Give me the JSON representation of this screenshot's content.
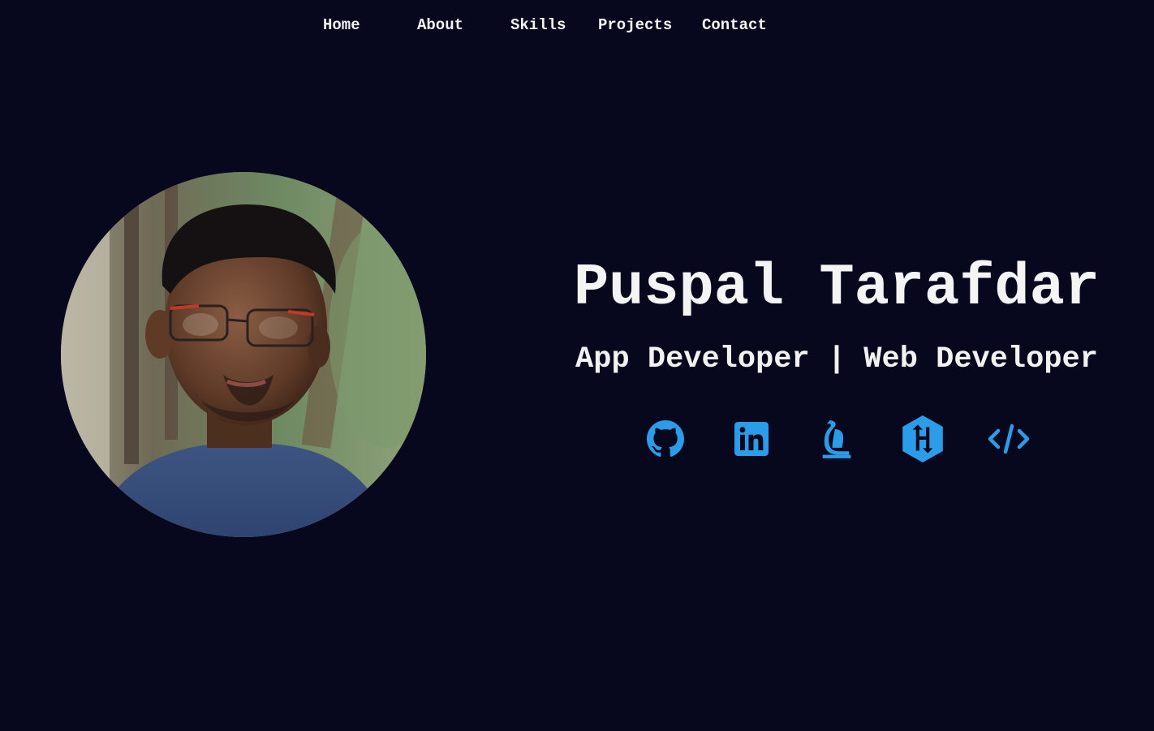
{
  "nav": {
    "items": [
      {
        "label": "Home"
      },
      {
        "label": "About"
      },
      {
        "label": "Skills"
      },
      {
        "label": "Projects"
      },
      {
        "label": "Contact"
      }
    ]
  },
  "hero": {
    "name": "Puspal Tarafdar",
    "role": "App Developer | Web Developer",
    "avatar_icon": "profile-photo"
  },
  "social": {
    "accent_color": "#2b9ce8",
    "links": [
      {
        "icon": "github-icon"
      },
      {
        "icon": "linkedin-icon"
      },
      {
        "icon": "leetcode-icon"
      },
      {
        "icon": "hackerrank-icon"
      },
      {
        "icon": "code-icon"
      }
    ]
  },
  "colors": {
    "background": "#07081d",
    "text": "#f2f2f2",
    "accent": "#2b9ce8"
  }
}
